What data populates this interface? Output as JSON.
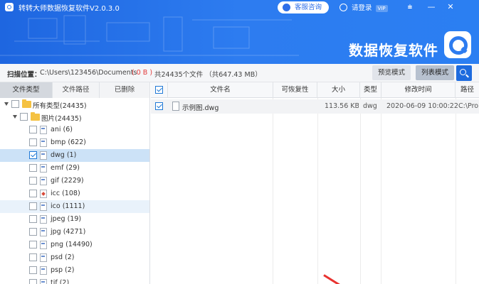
{
  "app": {
    "title": "转转大师数据恢复软件V2.0.3.0",
    "brand_text": "数据恢复软件",
    "service_label": "客服咨询",
    "login_label": "请登录",
    "vip_label": "VIP",
    "menu_glyph": "⩧",
    "minimize_glyph": "—",
    "close_glyph": "✕"
  },
  "scan": {
    "label": "扫描位置：",
    "path": "C:\\Users\\123456\\Documents",
    "size": "( 0 B )",
    "count": "共24435个文件 （共647.43 MB）",
    "preview_mode_label": "预览模式",
    "list_mode_label": "列表模式"
  },
  "left_tabs": [
    {
      "label": "文件类型",
      "active": true
    },
    {
      "label": "文件路径",
      "active": false
    },
    {
      "label": "已删除",
      "active": false
    }
  ],
  "tree": [
    {
      "label": "所有类型(24435)",
      "level": 0,
      "type": "folder",
      "checked": false,
      "expanded": true,
      "selected": false
    },
    {
      "label": "图片(24435)",
      "level": 1,
      "type": "folder",
      "checked": false,
      "expanded": true,
      "selected": false
    },
    {
      "label": "ani (6)",
      "level": 2,
      "type": "file",
      "checked": false,
      "selected": false
    },
    {
      "label": "bmp (622)",
      "level": 2,
      "type": "file",
      "checked": false,
      "selected": false
    },
    {
      "label": "dwg (1)",
      "level": 2,
      "type": "file",
      "checked": true,
      "selected": true
    },
    {
      "label": "emf (29)",
      "level": 2,
      "type": "file",
      "checked": false,
      "selected": false
    },
    {
      "label": "gif (2229)",
      "level": 2,
      "type": "file",
      "checked": false,
      "selected": false
    },
    {
      "label": "icc (108)",
      "level": 2,
      "type": "icc",
      "checked": false,
      "selected": false
    },
    {
      "label": "ico (1111)",
      "level": 2,
      "type": "file",
      "checked": false,
      "selected": false,
      "hover": true
    },
    {
      "label": "jpeg (19)",
      "level": 2,
      "type": "file",
      "checked": false,
      "selected": false
    },
    {
      "label": "jpg (4271)",
      "level": 2,
      "type": "file",
      "checked": false,
      "selected": false
    },
    {
      "label": "png (14490)",
      "level": 2,
      "type": "file",
      "checked": false,
      "selected": false
    },
    {
      "label": "psd (2)",
      "level": 2,
      "type": "file",
      "checked": false,
      "selected": false
    },
    {
      "label": "psp (2)",
      "level": 2,
      "type": "file",
      "checked": false,
      "selected": false
    },
    {
      "label": "tif (2)",
      "level": 2,
      "type": "file",
      "checked": false,
      "selected": false
    }
  ],
  "table": {
    "columns": [
      "文件名",
      "可恢复性",
      "大小",
      "类型",
      "修改时间",
      "路径"
    ],
    "rows": [
      {
        "name": "示例图.dwg",
        "recover": "",
        "size": "113.56 KB",
        "type": "dwg",
        "modified": "2020-06-09 10:00:22",
        "path": "C:\\Pro",
        "checked": true
      }
    ]
  }
}
